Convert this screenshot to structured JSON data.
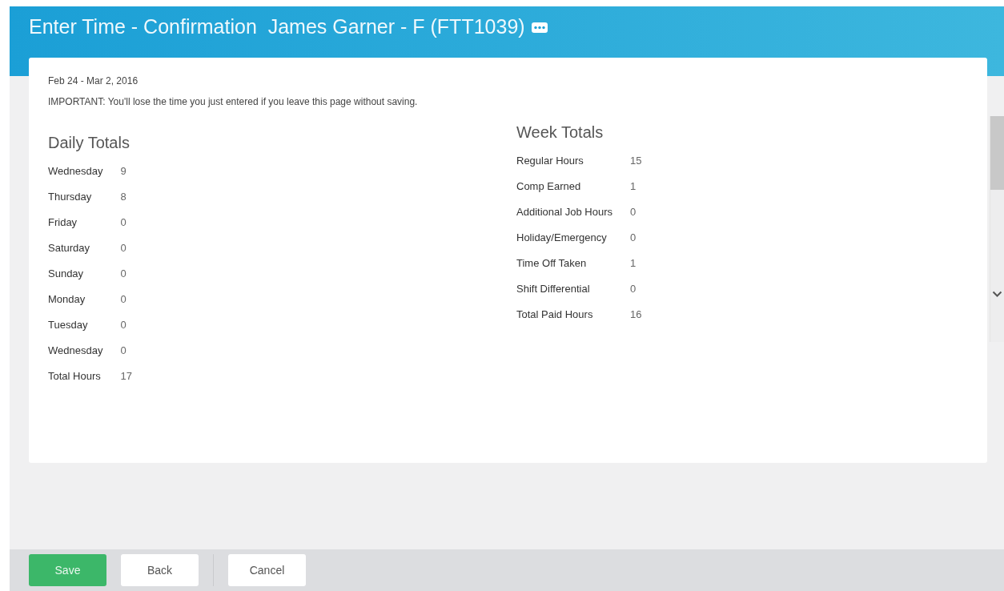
{
  "header": {
    "title": "Enter Time - Confirmation",
    "worker": "James Garner - F (FTT1039)"
  },
  "period": "Feb 24 - Mar 2, 2016",
  "warning": "IMPORTANT: You'll lose the time you just entered if you leave this page without saving.",
  "daily_totals": {
    "heading": "Daily Totals",
    "rows": [
      {
        "label": "Wednesday",
        "value": "9"
      },
      {
        "label": "Thursday",
        "value": "8"
      },
      {
        "label": "Friday",
        "value": "0"
      },
      {
        "label": "Saturday",
        "value": "0"
      },
      {
        "label": "Sunday",
        "value": "0"
      },
      {
        "label": "Monday",
        "value": "0"
      },
      {
        "label": "Tuesday",
        "value": "0"
      },
      {
        "label": "Wednesday",
        "value": "0"
      },
      {
        "label": "Total Hours",
        "value": "17"
      }
    ]
  },
  "week_totals": {
    "heading": "Week Totals",
    "rows": [
      {
        "label": "Regular Hours",
        "value": "15"
      },
      {
        "label": "Comp Earned",
        "value": "1"
      },
      {
        "label": "Additional Job Hours",
        "value": "0"
      },
      {
        "label": "Holiday/Emergency",
        "value": "0"
      },
      {
        "label": "Time Off Taken",
        "value": "1"
      },
      {
        "label": "Shift Differential",
        "value": "0"
      },
      {
        "label": "Total Paid Hours",
        "value": "16"
      }
    ]
  },
  "buttons": [
    {
      "label": "Save",
      "kind": "primary"
    },
    {
      "label": "Back",
      "kind": "secondary"
    },
    {
      "label": "Cancel",
      "kind": "secondary"
    }
  ]
}
